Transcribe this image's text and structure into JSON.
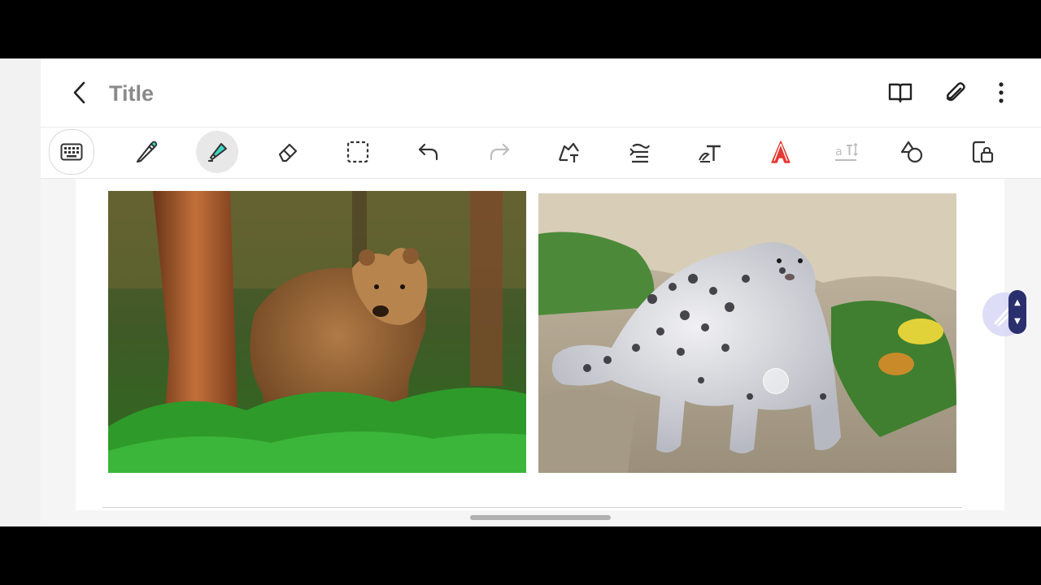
{
  "header": {
    "title": "Title"
  },
  "icons": {
    "back": "chevron-left-icon",
    "reading_mode": "open-book-icon",
    "attach": "paperclip-icon",
    "more": "more-vertical-icon"
  },
  "toolbar": {
    "tools": [
      {
        "name": "keyboard",
        "icon": "keyboard-icon"
      },
      {
        "name": "pen",
        "icon": "pen-icon"
      },
      {
        "name": "highlighter",
        "icon": "highlighter-icon",
        "selected": true
      },
      {
        "name": "eraser",
        "icon": "eraser-icon"
      },
      {
        "name": "selection",
        "icon": "lasso-select-icon"
      },
      {
        "name": "undo",
        "icon": "undo-icon"
      },
      {
        "name": "redo",
        "icon": "redo-icon",
        "disabled": true
      },
      {
        "name": "shape-convert",
        "icon": "pen-to-shape-icon"
      },
      {
        "name": "straighten",
        "icon": "straighten-lines-icon"
      },
      {
        "name": "handwriting-to-text",
        "icon": "pen-text-icon"
      },
      {
        "name": "text-style",
        "icon": "text-color-icon"
      },
      {
        "name": "text-size",
        "icon": "text-size-icon",
        "disabled": true
      },
      {
        "name": "shapes",
        "icon": "shapes-icon"
      },
      {
        "name": "lock",
        "icon": "lock-page-icon"
      }
    ]
  },
  "content": {
    "images": [
      {
        "name": "brown-bear-photo"
      },
      {
        "name": "snow-leopard-photo"
      }
    ]
  },
  "colors": {
    "accent_highlighter": "#3dd6c3",
    "text_style_red": "#e53935",
    "fab_pill": "#2a2f6e"
  }
}
